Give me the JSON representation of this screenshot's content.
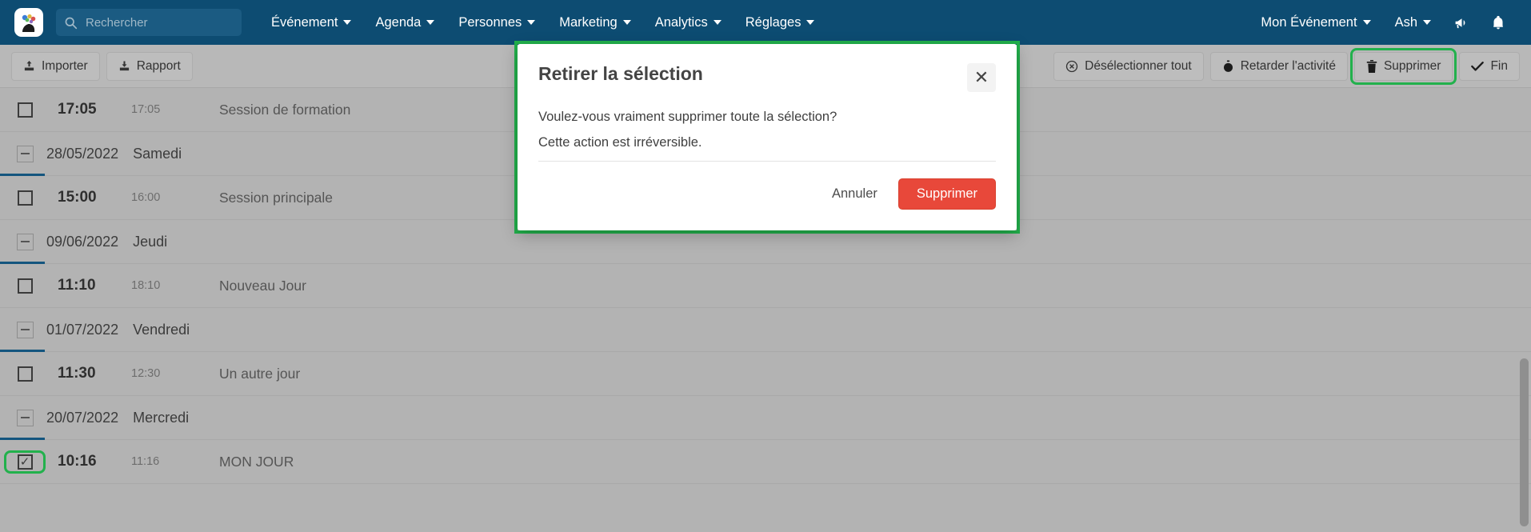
{
  "topnav": {
    "logo_name": "event-logo",
    "search": {
      "placeholder": "Rechercher",
      "value": ""
    },
    "items": [
      {
        "label": "Événement",
        "name": "nav-evenement"
      },
      {
        "label": "Agenda",
        "name": "nav-agenda"
      },
      {
        "label": "Personnes",
        "name": "nav-personnes"
      },
      {
        "label": "Marketing",
        "name": "nav-marketing"
      },
      {
        "label": "Analytics",
        "name": "nav-analytics"
      },
      {
        "label": "Réglages",
        "name": "nav-reglages"
      }
    ],
    "right": {
      "event_label": "Mon Événement",
      "user_label": "Ash",
      "announce_icon": "megaphone-icon",
      "notifications_icon": "bell-icon"
    }
  },
  "toolbar": {
    "import_label": "Importer",
    "report_label": "Rapport",
    "deselect_all_label": "Désélectionner tout",
    "delay_activity_label": "Retarder l'activité",
    "delete_label": "Supprimer",
    "finish_label": "Fin"
  },
  "agenda": {
    "rows": [
      {
        "type": "session",
        "checked": false,
        "start": "17:05",
        "end": "17:05",
        "title": "Session de formation"
      },
      {
        "type": "date",
        "date": "28/05/2022",
        "weekday": "Samedi"
      },
      {
        "type": "session",
        "checked": false,
        "start": "15:00",
        "end": "16:00",
        "title": "Session principale"
      },
      {
        "type": "date",
        "date": "09/06/2022",
        "weekday": "Jeudi"
      },
      {
        "type": "session",
        "checked": false,
        "start": "11:10",
        "end": "18:10",
        "title": "Nouveau Jour"
      },
      {
        "type": "date",
        "date": "01/07/2022",
        "weekday": "Vendredi"
      },
      {
        "type": "session",
        "checked": false,
        "start": "11:30",
        "end": "12:30",
        "title": "Un autre jour"
      },
      {
        "type": "date",
        "date": "20/07/2022",
        "weekday": "Mercredi"
      },
      {
        "type": "session",
        "checked": true,
        "highlighted": true,
        "start": "10:16",
        "end": "11:16",
        "title": "MON JOUR"
      }
    ],
    "checked_glyph": "✓"
  },
  "modal": {
    "title": "Retirer la sélection",
    "close_glyph": "✕",
    "line1": "Voulez-vous vraiment supprimer toute la sélection?",
    "line2": "Cette action est irréversible.",
    "cancel_label": "Annuler",
    "confirm_label": "Supprimer"
  },
  "colors": {
    "nav_blue": "#0d4c72",
    "page_gray": "#b3b3b3",
    "toolbar_gray": "#b8b8b8",
    "highlight_green": "#22b14c",
    "danger_red": "#e8483a",
    "group_accent": "#14557e"
  }
}
